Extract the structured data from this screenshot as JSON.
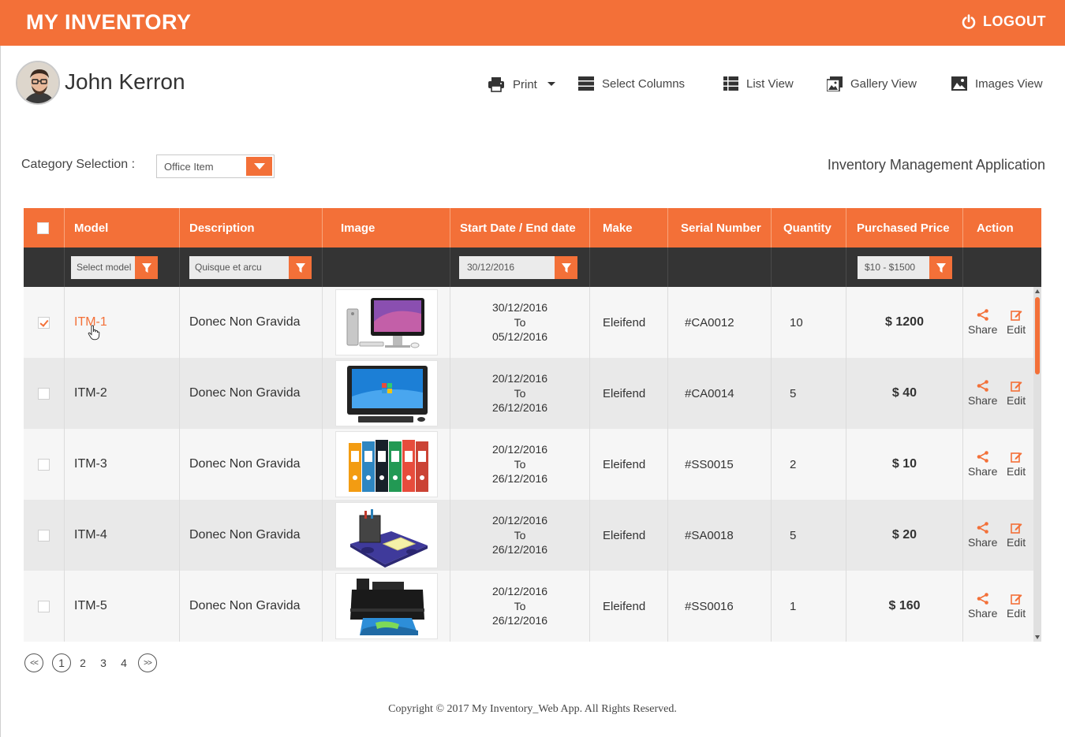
{
  "app": {
    "title": "MY INVENTORY",
    "logout_label": "LOGOUT"
  },
  "user": {
    "name": "John Kerron"
  },
  "toolbar": {
    "print": "Print",
    "select_columns": "Select Columns",
    "list_view": "List View",
    "gallery_view": "Gallery View",
    "images_view": "Images View"
  },
  "category": {
    "label": "Category Selection :",
    "selected": "Office Item"
  },
  "page_subtitle": "Inventory Management Application",
  "table": {
    "columns": [
      "Model",
      "Description",
      "Image",
      "Start Date / End date",
      "Make",
      "Serial Number",
      "Quantity",
      "Purchased Price",
      "Action"
    ],
    "filters": {
      "model": "Select model",
      "description": "Quisque et arcu",
      "date": "30/12/2016",
      "price": "$10 - $1500"
    },
    "date_separator": "To",
    "action_share": "Share",
    "action_edit": "Edit",
    "rows": [
      {
        "model": "ITM-1",
        "description": "Donec Non Gravida",
        "image": "imac-computer",
        "start": "30/12/2016",
        "end": "05/12/2016",
        "make": "Eleifend",
        "serial": "#CA0012",
        "quantity": "10",
        "price": "$ 1200",
        "checked": true
      },
      {
        "model": "ITM-2",
        "description": "Donec Non Gravida",
        "image": "desktop-computer",
        "start": "20/12/2016",
        "end": "26/12/2016",
        "make": "Eleifend",
        "serial": "#CA0014",
        "quantity": "5",
        "price": "$ 40",
        "checked": false
      },
      {
        "model": "ITM-3",
        "description": "Donec Non Gravida",
        "image": "file-binders",
        "start": "20/12/2016",
        "end": "26/12/2016",
        "make": "Eleifend",
        "serial": "#SS0015",
        "quantity": "2",
        "price": "$ 10",
        "checked": false
      },
      {
        "model": "ITM-4",
        "description": "Donec Non Gravida",
        "image": "desk-organizer",
        "start": "20/12/2016",
        "end": "26/12/2016",
        "make": "Eleifend",
        "serial": "#SA0018",
        "quantity": "5",
        "price": "$ 20",
        "checked": false
      },
      {
        "model": "ITM-5",
        "description": "Donec Non Gravida",
        "image": "printer",
        "start": "20/12/2016",
        "end": "26/12/2016",
        "make": "Eleifend",
        "serial": "#SS0016",
        "quantity": "1",
        "price": "$ 160",
        "checked": false
      }
    ]
  },
  "pagination": {
    "first": "<<",
    "pages": [
      "1",
      "2",
      "3",
      "4"
    ],
    "current": "1",
    "last": ">>"
  },
  "footer": "Copyright © 2017 My Inventory_Web App.  All Rights Reserved.",
  "colors": {
    "accent": "#f37038",
    "filter_bar": "#343434"
  }
}
